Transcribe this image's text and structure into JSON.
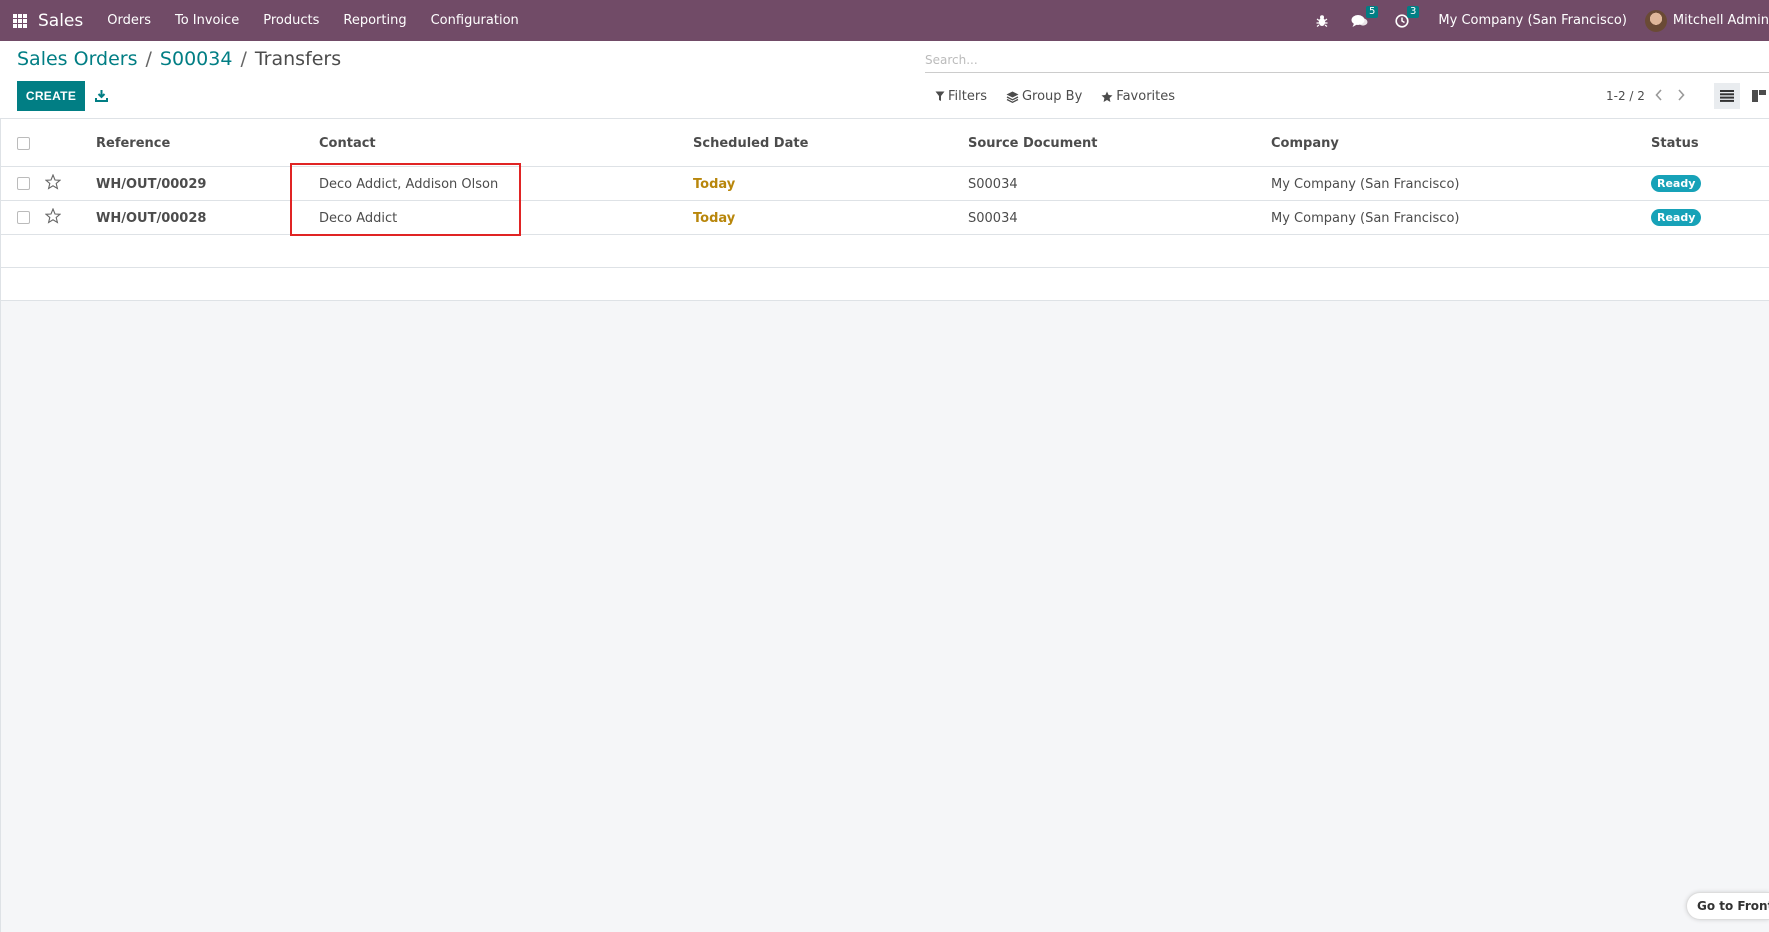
{
  "navbar": {
    "app_name": "Sales",
    "menu": [
      "Orders",
      "To Invoice",
      "Products",
      "Reporting",
      "Configuration"
    ],
    "messages_count": "5",
    "activities_count": "3",
    "company": "My Company (San Francisco)",
    "user": "Mitchell Admin"
  },
  "breadcrumb": {
    "items": [
      "Sales Orders",
      "S00034"
    ],
    "separator": "/",
    "current": "Transfers"
  },
  "search": {
    "placeholder": "Search..."
  },
  "toolbar": {
    "create_label": "CREATE",
    "filters_label": "Filters",
    "groupby_label": "Group By",
    "favorites_label": "Favorites"
  },
  "pager": {
    "text": "1-2 / 2"
  },
  "table": {
    "columns": [
      "Reference",
      "Contact",
      "Scheduled Date",
      "Source Document",
      "Company",
      "Status"
    ],
    "rows": [
      {
        "reference": "WH/OUT/00029",
        "contact": "Deco Addict, Addison Olson",
        "scheduled_date": "Today",
        "source_document": "S00034",
        "company": "My Company (San Francisco)",
        "status": "Ready"
      },
      {
        "reference": "WH/OUT/00028",
        "contact": "Deco Addict",
        "scheduled_date": "Today",
        "source_document": "S00034",
        "company": "My Company (San Francisco)",
        "status": "Ready"
      }
    ]
  },
  "footer": {
    "goto_frontend": "Go to Frontend"
  },
  "colors": {
    "navbar": "#714b67",
    "primary": "#017e84",
    "status_ready": "#17a2b8",
    "date_today": "#b8860b",
    "highlight": "#e02424"
  },
  "icons": [
    "apps-icon",
    "bug-icon",
    "chat-icon",
    "clock-icon",
    "download-icon",
    "filter-icon",
    "layers-icon",
    "star-icon",
    "chevron-left-icon",
    "chevron-right-icon",
    "list-view-icon",
    "kanban-view-icon"
  ]
}
